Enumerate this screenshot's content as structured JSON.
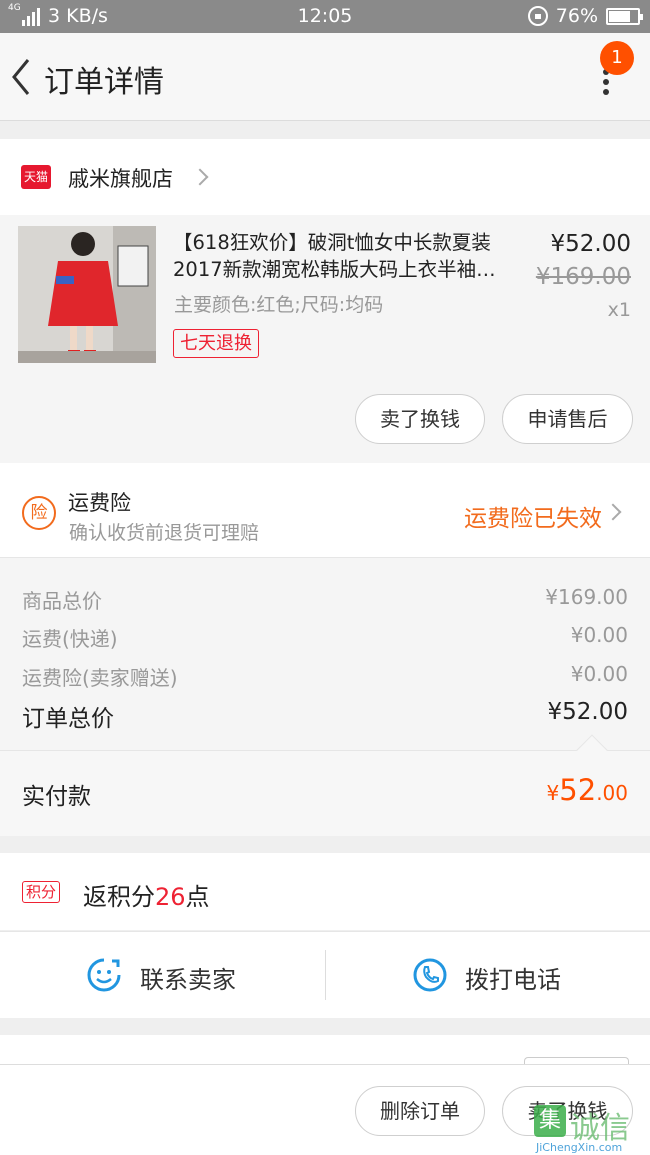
{
  "status_bar": {
    "network": "4G",
    "speed": "3 KB/s",
    "time": "12:05",
    "battery": "76%",
    "battery_level": 0.76
  },
  "nav": {
    "title": "订单详情",
    "badge": "1"
  },
  "shop": {
    "badge": "天猫",
    "name": "戚米旗舰店"
  },
  "item": {
    "title": "【618狂欢价】破洞t恤女中长款夏装2017新款潮宽松韩版大码上衣半袖…",
    "spec": "主要颜色:红色;尺码:均码",
    "tag": "七天退换",
    "price": "¥52.00",
    "original_price": "¥169.00",
    "quantity": "x1",
    "actions": [
      "卖了换钱",
      "申请售后"
    ]
  },
  "insurance": {
    "icon": "险",
    "title": "运费险",
    "subtitle": "确认收货前退货可理赔",
    "status": "运费险已失效"
  },
  "summary": [
    {
      "label": "商品总价",
      "value": "¥169.00"
    },
    {
      "label": "运费(快递)",
      "value": "¥0.00"
    },
    {
      "label": "运费险(卖家赠送)",
      "value": "¥0.00"
    }
  ],
  "order_total": {
    "label": "订单总价",
    "value": "¥52.00"
  },
  "payment": {
    "label": "实付款",
    "currency": "¥",
    "integer": "52",
    "decimal": ".00"
  },
  "points": {
    "badge": "积分",
    "prefix": "返积分",
    "amount": "26",
    "suffix": "点"
  },
  "contact": {
    "seller": "联系卖家",
    "phone": "拨打电话"
  },
  "bottom": {
    "buttons": [
      "删除订单",
      "卖了换钱"
    ]
  },
  "watermark": {
    "mark": "集",
    "cn": "诚信",
    "en": "JiChengXin.com"
  },
  "colors": {
    "accent": "#ff5000",
    "insurance_orange": "#f26b1d",
    "tmall_red": "#e6182f",
    "icon_blue": "#2196e0"
  }
}
